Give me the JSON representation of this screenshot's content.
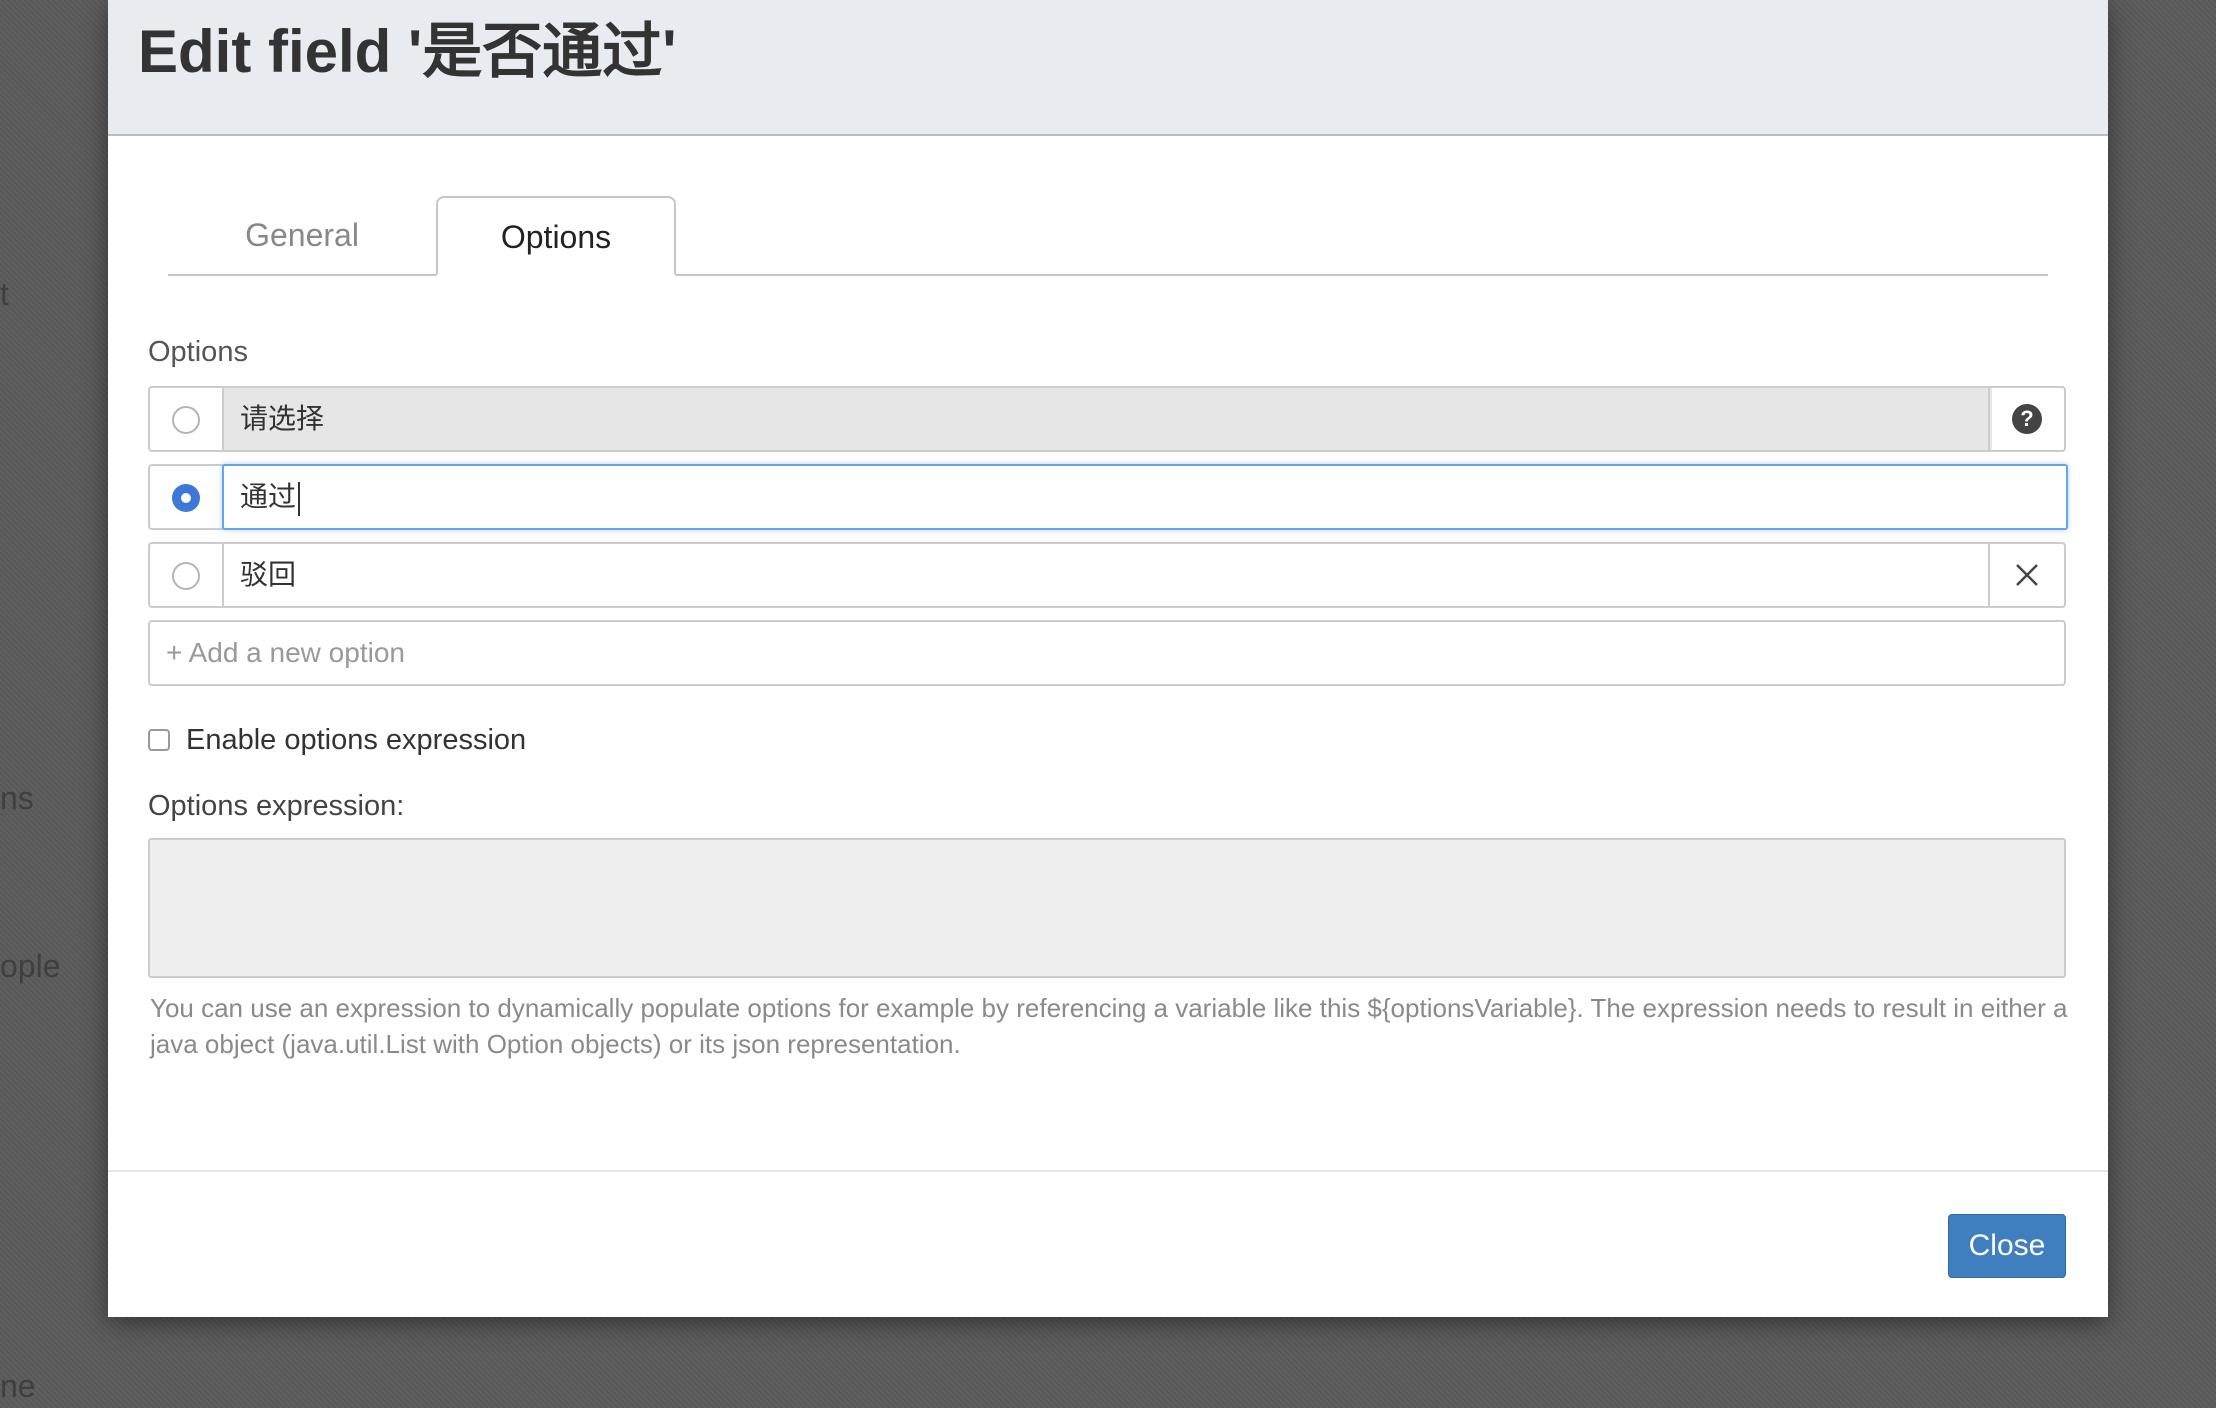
{
  "background": {
    "fragments": [
      "t",
      "ns",
      "ople",
      "ne"
    ]
  },
  "dialog": {
    "title": "Edit field '是否通过'"
  },
  "tabs": [
    {
      "label": "General",
      "active": false
    },
    {
      "label": "Options",
      "active": true
    }
  ],
  "options_section": {
    "label": "Options",
    "items": [
      {
        "value": "请选择",
        "selected": false,
        "addon_icon": "question-circle-icon"
      },
      {
        "value": "通过",
        "selected": true,
        "addon_icon": ""
      },
      {
        "value": "驳回",
        "selected": false,
        "addon_icon": "close-icon"
      }
    ],
    "add_placeholder": "+ Add a new option"
  },
  "expression": {
    "checkbox_label": "Enable options expression",
    "checked": false,
    "label": "Options expression:",
    "value": "",
    "help_text": "You can use an expression to dynamically populate options for example by referencing a variable like this ${optionsVariable}. The expression needs to result in either a java object (java.util.List with Option objects) or its json representation."
  },
  "footer": {
    "close_label": "Close"
  },
  "colors": {
    "accent": "#3c78d8",
    "button": "#3f7fbf",
    "header_bg": "#e8ebef",
    "focus_border": "#66a3ea"
  }
}
